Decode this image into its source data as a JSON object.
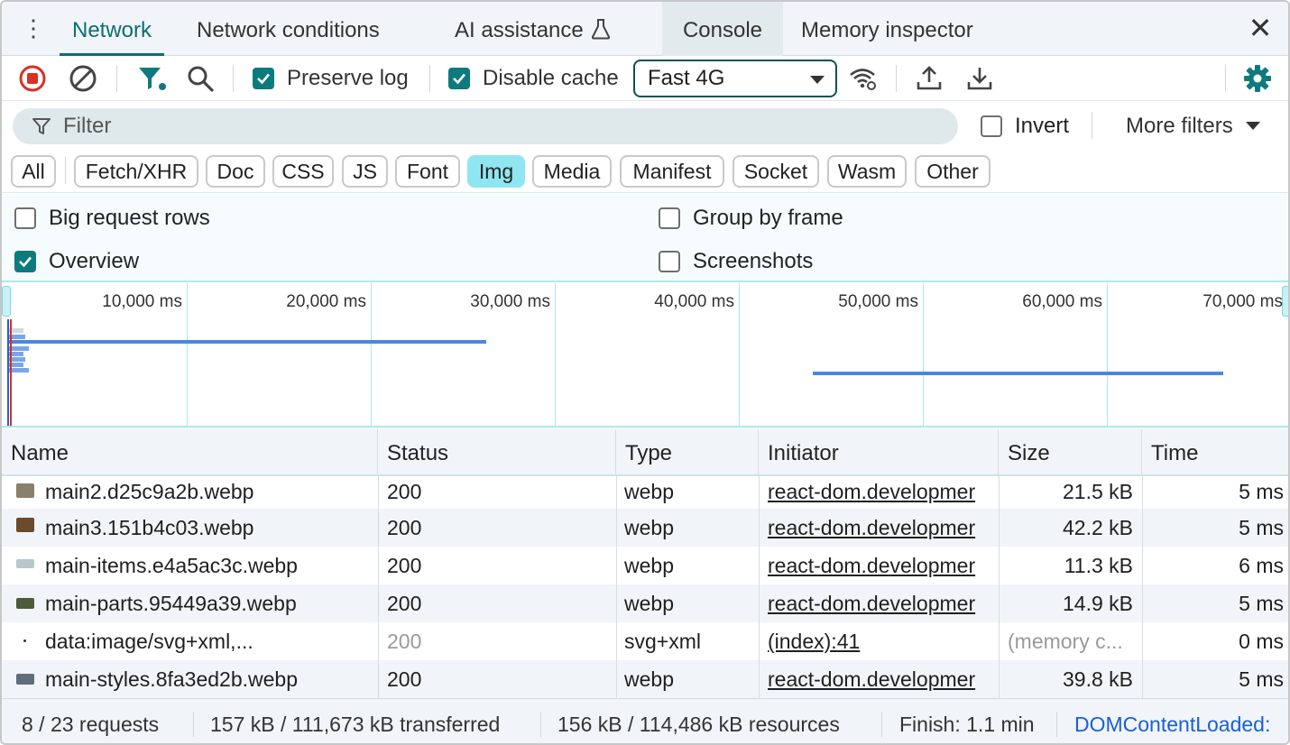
{
  "tabs": [
    {
      "label": "Network",
      "active": true
    },
    {
      "label": "Network conditions",
      "active": false
    },
    {
      "label": "AI assistance",
      "active": false,
      "icon": "flask-icon"
    },
    {
      "label": "Console",
      "active": false
    },
    {
      "label": "Memory inspector",
      "active": false
    }
  ],
  "toolbar": {
    "preserve_log": {
      "label": "Preserve log",
      "checked": true
    },
    "disable_cache": {
      "label": "Disable cache",
      "checked": true
    },
    "throttling": "Fast 4G"
  },
  "filter": {
    "placeholder": "Filter",
    "invert": {
      "label": "Invert",
      "checked": false
    },
    "more_filters": "More filters"
  },
  "type_filters": [
    {
      "label": "All",
      "active": false
    },
    {
      "label": "Fetch/XHR",
      "active": false
    },
    {
      "label": "Doc",
      "active": false
    },
    {
      "label": "CSS",
      "active": false
    },
    {
      "label": "JS",
      "active": false
    },
    {
      "label": "Font",
      "active": false
    },
    {
      "label": "Img",
      "active": true
    },
    {
      "label": "Media",
      "active": false
    },
    {
      "label": "Manifest",
      "active": false
    },
    {
      "label": "Socket",
      "active": false
    },
    {
      "label": "Wasm",
      "active": false
    },
    {
      "label": "Other",
      "active": false
    }
  ],
  "options": {
    "big_request_rows": {
      "label": "Big request rows",
      "checked": false
    },
    "group_by_frame": {
      "label": "Group by frame",
      "checked": false
    },
    "overview": {
      "label": "Overview",
      "checked": true
    },
    "screenshots": {
      "label": "Screenshots",
      "checked": false
    }
  },
  "timeline": {
    "ticks": [
      "10,000 ms",
      "20,000 ms",
      "30,000 ms",
      "40,000 ms",
      "50,000 ms",
      "60,000 ms",
      "70,000 ms"
    ]
  },
  "table": {
    "headers": [
      "Name",
      "Status",
      "Type",
      "Initiator",
      "Size",
      "Time"
    ],
    "rows": [
      {
        "name": "main2.d25c9a2b.webp",
        "status": "200",
        "type": "webp",
        "initiator": "react-dom.developmer",
        "size": "21.5 kB",
        "time": "5 ms",
        "thumb": "#8a7f6a"
      },
      {
        "name": "main3.151b4c03.webp",
        "status": "200",
        "type": "webp",
        "initiator": "react-dom.developmer",
        "size": "42.2 kB",
        "time": "5 ms",
        "thumb": "#6b4a2e"
      },
      {
        "name": "main-items.e4a5ac3c.webp",
        "status": "200",
        "type": "webp",
        "initiator": "react-dom.developmer",
        "size": "11.3 kB",
        "time": "6 ms",
        "thumb": "#b9c7c9"
      },
      {
        "name": "main-parts.95449a39.webp",
        "status": "200",
        "type": "webp",
        "initiator": "react-dom.developmer",
        "size": "14.9 kB",
        "time": "5 ms",
        "thumb": "#4e5a3c"
      },
      {
        "name": "data:image/svg+xml,...",
        "status": "200",
        "type": "svg+xml",
        "initiator": "(index):41",
        "size": "(memory c...",
        "time": "0 ms",
        "thumb": "",
        "muted": true
      },
      {
        "name": "main-styles.8fa3ed2b.webp",
        "status": "200",
        "type": "webp",
        "initiator": "react-dom.developmer",
        "size": "39.8 kB",
        "time": "5 ms",
        "thumb": "#5f6e7a"
      }
    ]
  },
  "status_bar": {
    "requests": "8 / 23 requests",
    "transferred": "157 kB / 111,673 kB transferred",
    "resources": "156 kB / 114,486 kB resources",
    "finish": "Finish: 1.1 min",
    "dom_content_loaded": "DOMContentLoaded:"
  },
  "colors": {
    "accent": "#0b6e73",
    "active_chip": "#8fe6f0",
    "timeline_bar": "#4a86e0",
    "dom_content_loaded": "#1a5fd8",
    "record_icon": "#d93025"
  }
}
